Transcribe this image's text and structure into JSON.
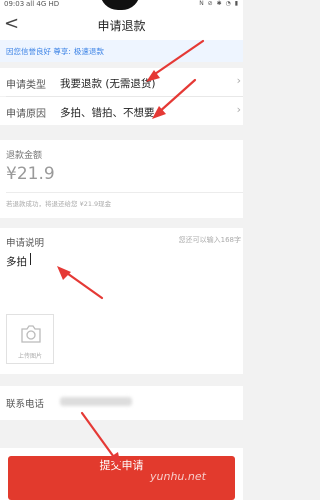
{
  "status_bar": {
    "time": "09:03",
    "signal": "all 4G HD",
    "icons": "N ⊘ ✱ ◔ ▮"
  },
  "nav": {
    "back_label": "<",
    "title": "申请退款"
  },
  "notice": {
    "text": "因您信誉良好 尊享:",
    "highlight": "极速退款"
  },
  "request_type": {
    "label": "申请类型",
    "value": "我要退款 (无需退货)"
  },
  "request_reason": {
    "label": "申请原因",
    "value": "多拍、错拍、不想要"
  },
  "refund": {
    "label": "退款金额",
    "amount": "¥21.9",
    "hint": "若退款成功，将退还给您 ¥21.9现金"
  },
  "description": {
    "label": "申请说明",
    "counter": "您还可以输入168字",
    "value": "多拍"
  },
  "upload": {
    "label": "上传图片"
  },
  "phone": {
    "label": "联系电话"
  },
  "submit": {
    "label": "提交申请"
  },
  "watermark": "yunhu.net",
  "colors": {
    "accent": "#e23a2d",
    "notice_text": "#3c83e6",
    "annotation": "#e53935"
  }
}
